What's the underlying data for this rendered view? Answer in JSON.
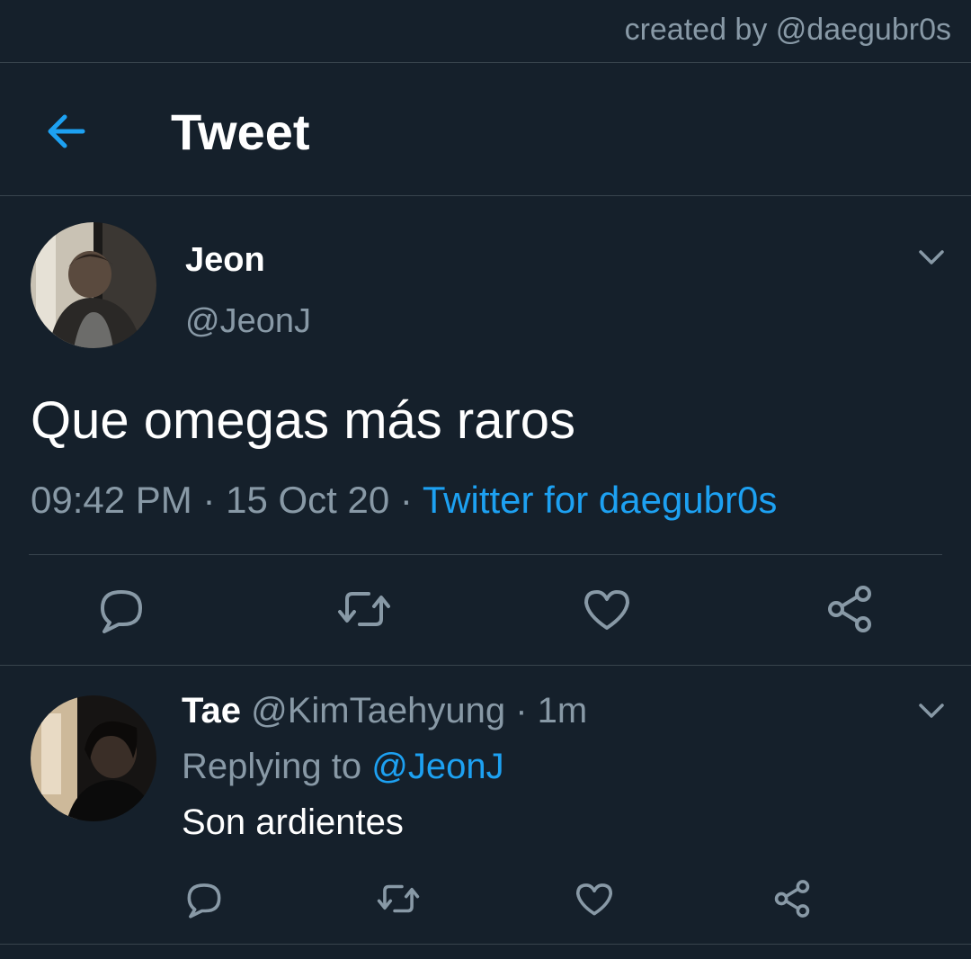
{
  "credit": "created by @daegubr0s",
  "header": {
    "title": "Tweet"
  },
  "main_tweet": {
    "author_name": "Jeon",
    "author_handle": "@JeonJ",
    "text": "Que omegas más raros",
    "time": "09:42 PM",
    "separator": "·",
    "date": "15 Oct 20",
    "source": "Twitter for daegubr0s"
  },
  "reply": {
    "author_name": "Tae",
    "author_handle": "@KimTaehyung",
    "separator": "·",
    "age": "1m",
    "replying_prefix": "Replying to",
    "replying_to": "@JeonJ",
    "text": "Son ardientes"
  },
  "icons": {
    "back": "arrow-left-icon",
    "menu": "chevron-down-icon",
    "reply": "comment-icon",
    "retweet": "retweet-icon",
    "like": "heart-icon",
    "share": "share-icon"
  },
  "colors": {
    "background": "#15202b",
    "accent": "#1da1f2",
    "secondary_text": "#8899a6",
    "divider": "#38444d"
  }
}
